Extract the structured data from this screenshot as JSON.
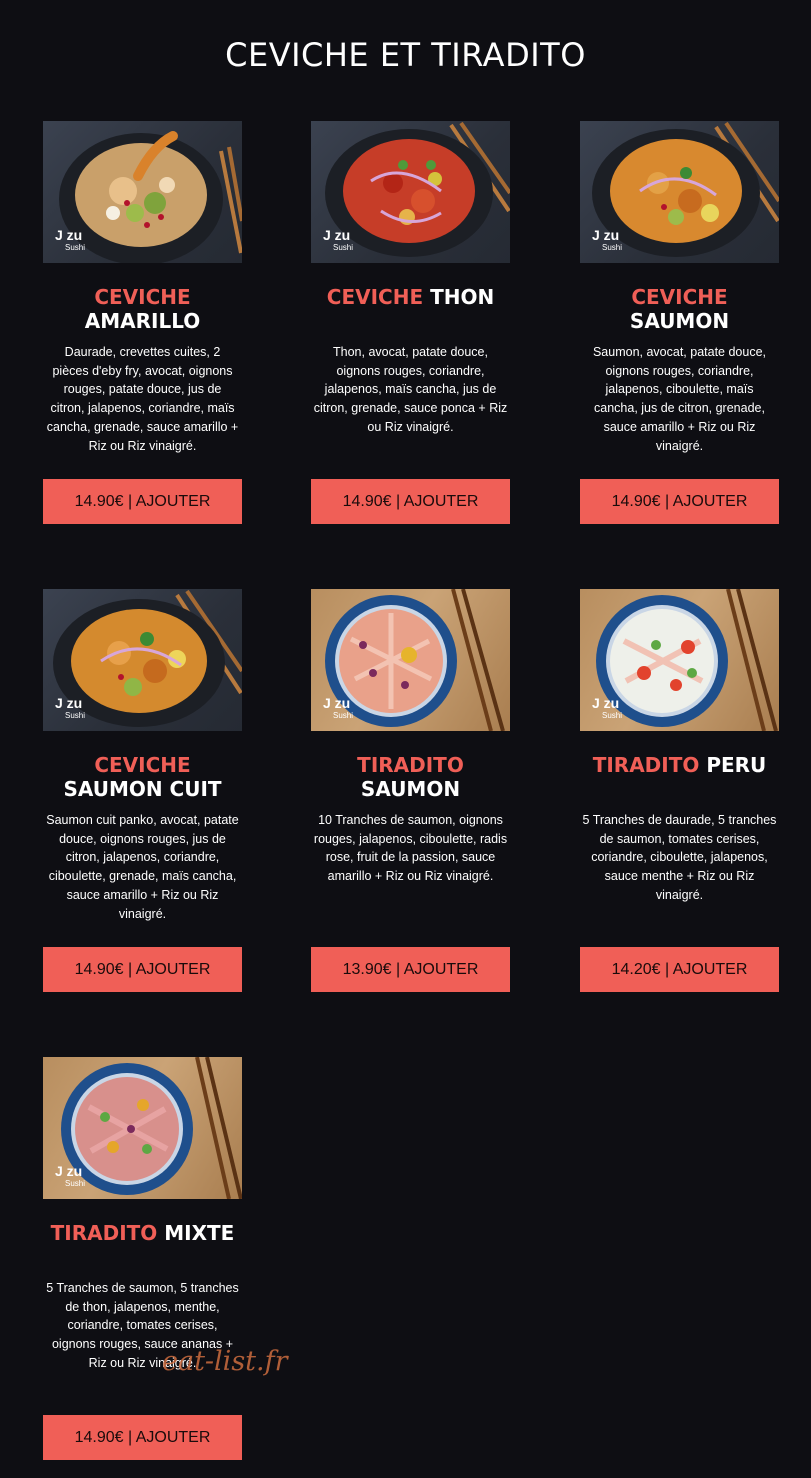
{
  "page": {
    "title": "CEVICHE ET TIRADITO",
    "watermark": "eat-list.fr"
  },
  "colors": {
    "background": "#0e0e13",
    "accent": "#f05f57",
    "text": "#ffffff"
  },
  "photo_logo": {
    "brand": "J zu",
    "sub": "Sushi"
  },
  "products": [
    {
      "name_accent": "CEVICHE",
      "name_rest": "AMARILLO",
      "description": "Daurade, crevettes cuites, 2 pièces d'eby fry, avocat, oignons rouges, patate douce, jus de citron, jalapenos, coriandre, maïs cancha, grenade, sauce amarillo + Riz ou Riz vinaigré.",
      "button_label": "14.90€ | AJOUTER",
      "photo_style": "bowl"
    },
    {
      "name_accent": "CEVICHE",
      "name_rest": "THON",
      "description": "Thon, avocat, patate douce, oignons rouges, coriandre, jalapenos, maïs cancha, jus de citron, grenade, sauce ponca + Riz ou Riz vinaigré.",
      "button_label": "14.90€ | AJOUTER",
      "photo_style": "bowl"
    },
    {
      "name_accent": "CEVICHE",
      "name_rest": "SAUMON",
      "description": "Saumon, avocat, patate douce, oignons rouges, coriandre, jalapenos, ciboulette, maïs cancha, jus de citron, grenade, sauce amarillo + Riz ou Riz vinaigré.",
      "button_label": "14.90€ | AJOUTER",
      "photo_style": "bowl"
    },
    {
      "name_accent": "CEVICHE",
      "name_rest": "SAUMON CUIT",
      "description": "Saumon cuit panko, avocat, patate douce, oignons rouges, jus de citron, jalapenos, coriandre, ciboulette, grenade, maïs cancha, sauce amarillo + Riz ou Riz vinaigré.",
      "button_label": "14.90€ | AJOUTER",
      "photo_style": "bowl"
    },
    {
      "name_accent": "TIRADITO",
      "name_rest": "SAUMON",
      "description": "10 Tranches de saumon, oignons rouges, jalapenos, ciboulette, radis rose, fruit de la passion, sauce amarillo + Riz ou Riz vinaigré.",
      "button_label": "13.90€ | AJOUTER",
      "photo_style": "plate"
    },
    {
      "name_accent": "TIRADITO",
      "name_rest": "PERU",
      "description": "5 Tranches de daurade, 5 tranches de saumon, tomates cerises, coriandre, ciboulette, jalapenos, sauce menthe + Riz ou Riz vinaigré.",
      "button_label": "14.20€ | AJOUTER",
      "photo_style": "plate"
    },
    {
      "name_accent": "TIRADITO",
      "name_rest": "MIXTE",
      "description": "5 Tranches de saumon, 5 tranches de thon, jalapenos, menthe, coriandre, tomates cerises, oignons rouges, sauce ananas + Riz ou Riz vinaigré.",
      "button_label": "14.90€ | AJOUTER",
      "photo_style": "plate"
    }
  ]
}
